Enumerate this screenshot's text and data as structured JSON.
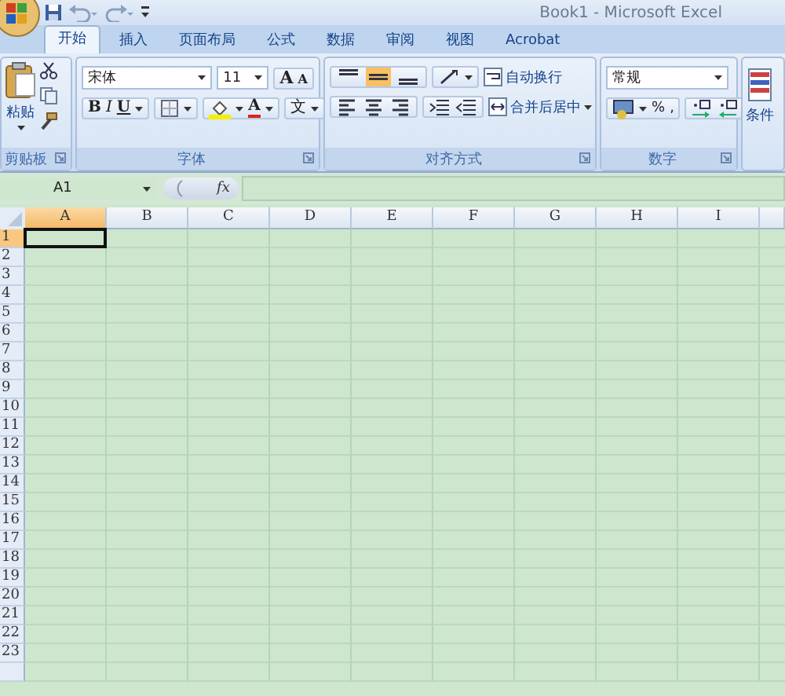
{
  "window": {
    "title": "Book1 - Microsoft Excel"
  },
  "tabs": [
    {
      "label": "开始",
      "selected": true
    },
    {
      "label": "插入",
      "selected": false
    },
    {
      "label": "页面布局",
      "selected": false
    },
    {
      "label": "公式",
      "selected": false
    },
    {
      "label": "数据",
      "selected": false
    },
    {
      "label": "审阅",
      "selected": false
    },
    {
      "label": "视图",
      "selected": false
    },
    {
      "label": "Acrobat",
      "selected": false
    }
  ],
  "ribbon": {
    "groups": [
      {
        "kind": "clipboard",
        "label": "剪贴板",
        "paste_label": "粘贴"
      },
      {
        "kind": "font",
        "label": "字体",
        "font_name": "宋体",
        "font_size": "11",
        "grow_font": "A",
        "shrink_font": "A",
        "bold": "B",
        "italic": "I",
        "underline": "U",
        "font_color": "A",
        "phonetic": "文"
      },
      {
        "kind": "alignment",
        "label": "对齐方式",
        "vertical_align": [
          {
            "selected": false
          },
          {
            "selected": true
          },
          {
            "selected": false
          }
        ],
        "wrap_text": "自动换行",
        "merge_center": "合并后居中"
      },
      {
        "kind": "number",
        "label": "数字",
        "format": "常规",
        "percent": "%",
        "comma": ","
      },
      {
        "kind": "styles",
        "button_label": "条件"
      }
    ]
  },
  "formula_bar": {
    "name_box": "A1",
    "fx": "fx"
  },
  "sheet": {
    "columns": [
      {
        "label": "A",
        "selected": true
      },
      {
        "label": "B",
        "selected": false
      },
      {
        "label": "C",
        "selected": false
      },
      {
        "label": "D",
        "selected": false
      },
      {
        "label": "E",
        "selected": false
      },
      {
        "label": "F",
        "selected": false
      },
      {
        "label": "G",
        "selected": false
      },
      {
        "label": "H",
        "selected": false
      },
      {
        "label": "I",
        "selected": false
      }
    ],
    "rows": [
      {
        "label": "1",
        "selected": true
      },
      {
        "label": "2",
        "selected": false
      },
      {
        "label": "3",
        "selected": false
      },
      {
        "label": "4",
        "selected": false
      },
      {
        "label": "5",
        "selected": false
      },
      {
        "label": "6",
        "selected": false
      },
      {
        "label": "7",
        "selected": false
      },
      {
        "label": "8",
        "selected": false
      },
      {
        "label": "9",
        "selected": false
      },
      {
        "label": "10",
        "selected": false
      },
      {
        "label": "11",
        "selected": false
      },
      {
        "label": "12",
        "selected": false
      },
      {
        "label": "13",
        "selected": false
      },
      {
        "label": "14",
        "selected": false
      },
      {
        "label": "15",
        "selected": false
      },
      {
        "label": "16",
        "selected": false
      },
      {
        "label": "17",
        "selected": false
      },
      {
        "label": "18",
        "selected": false
      },
      {
        "label": "19",
        "selected": false
      },
      {
        "label": "20",
        "selected": false
      },
      {
        "label": "21",
        "selected": false
      },
      {
        "label": "22",
        "selected": false
      },
      {
        "label": "23",
        "selected": false
      }
    ]
  }
}
